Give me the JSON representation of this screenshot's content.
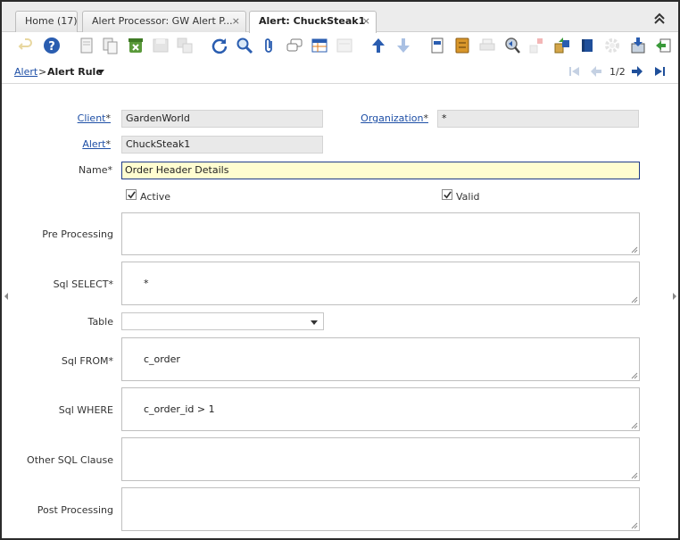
{
  "tabs": [
    {
      "label": "Home (17)"
    },
    {
      "label": "Alert Processor: GW Alert P...",
      "close": "×"
    },
    {
      "label": "Alert: ChuckSteak1",
      "close": "×"
    }
  ],
  "toolbar": {
    "icons": [
      "undo-icon",
      "help-icon",
      "new-record-icon",
      "copy-record-icon",
      "delete-icon",
      "save-icon",
      "save-new-icon",
      "refresh-icon",
      "find-icon",
      "attachment-icon",
      "chat-icon",
      "grid-toggle-icon",
      "parent-record-icon",
      "detail-record-icon",
      "report-icon",
      "archive-icon",
      "print-icon",
      "zoom-across-icon",
      "request-icon",
      "product-info-icon",
      "active-workflows-icon",
      "workflow-icon",
      "import-icon",
      "export-icon"
    ]
  },
  "breadcrumb": {
    "parent": "Alert",
    "separator": ">",
    "current": "Alert Rule"
  },
  "navigation": {
    "record_count": "1/2"
  },
  "form": {
    "client": {
      "label": "Client",
      "value": "GardenWorld"
    },
    "organization": {
      "label": "Organization",
      "value": "*"
    },
    "alert": {
      "label": "Alert",
      "value": "ChuckSteak1"
    },
    "name": {
      "label": "Name",
      "value": "Order Header Details"
    },
    "active": {
      "label": "Active",
      "checked": true
    },
    "valid": {
      "label": "Valid",
      "checked": true
    },
    "pre_processing": {
      "label": "Pre Processing",
      "value": ""
    },
    "sql_select": {
      "label": "Sql SELECT",
      "value": "*"
    },
    "table": {
      "label": "Table",
      "value": ""
    },
    "sql_from": {
      "label": "Sql FROM",
      "value": "c_order"
    },
    "sql_where": {
      "label": "Sql WHERE",
      "value": "c_order_id > 1"
    },
    "other_sql": {
      "label": "Other SQL Clause",
      "value": ""
    },
    "post_processing": {
      "label": "Post Processing",
      "value": ""
    }
  },
  "required_marker": "*",
  "colors": {
    "link": "#1e4fa6",
    "mandatory_bg": "#fffdd0",
    "readonly_bg": "#e9e9e9",
    "icon_blue": "#2a5db0"
  }
}
